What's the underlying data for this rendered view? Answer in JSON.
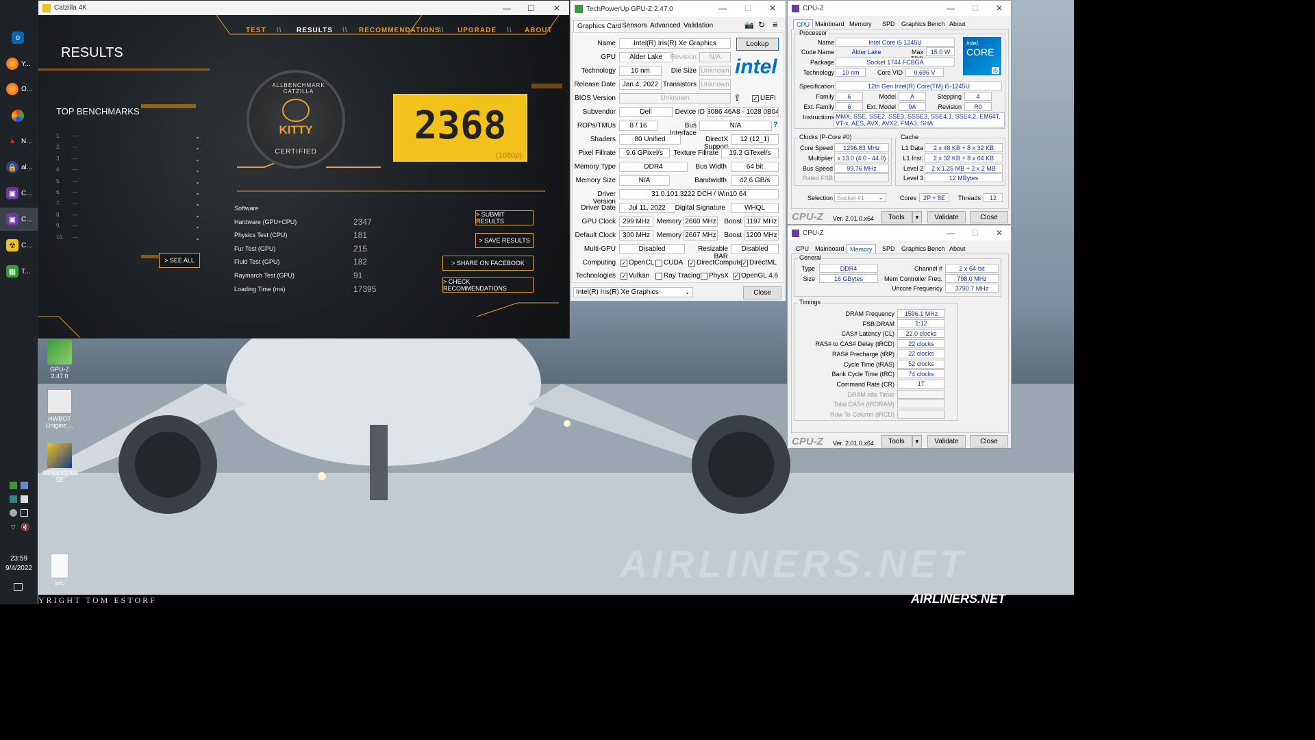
{
  "taskbar": {
    "items": [
      {
        "label": "",
        "icon": "windows-logo-icon"
      },
      {
        "label": "",
        "icon": "outlook-icon"
      },
      {
        "label": "Y...",
        "icon": "firefox-icon"
      },
      {
        "label": "O...",
        "icon": "firefox-icon"
      },
      {
        "label": "",
        "icon": "pinwheel-icon"
      },
      {
        "label": "N...",
        "icon": "acrobat-icon"
      },
      {
        "label": "al...",
        "icon": "lock-app-icon"
      },
      {
        "label": "C...",
        "icon": "cpuz-icon"
      },
      {
        "label": "C...",
        "icon": "cpuz-icon"
      },
      {
        "label": "C...",
        "icon": "catzilla-icon"
      },
      {
        "label": "T...",
        "icon": "gpuz-icon"
      }
    ],
    "clock_time": "23:59",
    "clock_date": "9/4/2022"
  },
  "desktop": {
    "icons": [
      {
        "label": "GPU-Z 2.47.0",
        "icon": "gpuz-shortcut-icon"
      },
      {
        "label": "HWBOT Unigine ...",
        "icon": "hwbot-icon"
      },
      {
        "label": "3DMark2001 SE",
        "icon": "3dmark-icon"
      },
      {
        "label": "info",
        "icon": "file-icon"
      }
    ],
    "watermark": "AIRLINERS.NET",
    "watermark_small": "AIRLINERS.NET",
    "copyright": "YRIGHT TOM ESTORF"
  },
  "catzilla": {
    "window_title": "Catzilla 4K",
    "nav": [
      "TEST",
      "RESULTS",
      "RECOMMENDATIONS",
      "UPGRADE",
      "ABOUT"
    ],
    "nav_sep": "\\\\",
    "results_heading": "RESULTS",
    "top_benchmarks_heading": "TOP BENCHMARKS",
    "top_list": [
      {
        "n": "1.",
        "v": "---"
      },
      {
        "n": "2.",
        "v": "---"
      },
      {
        "n": "3.",
        "v": "---"
      },
      {
        "n": "4.",
        "v": "---"
      },
      {
        "n": "5.",
        "v": "---"
      },
      {
        "n": "6.",
        "v": "---"
      },
      {
        "n": "7.",
        "v": "---"
      },
      {
        "n": "8.",
        "v": "---"
      },
      {
        "n": "9.",
        "v": "---"
      },
      {
        "n": "10.",
        "v": "---"
      }
    ],
    "see_all": "> SEE ALL",
    "badge_top": "ALLBENCHMARK CATZILLA",
    "badge_kitty": "KITTY",
    "badge_bottom": "CERTIFIED",
    "score": "2368",
    "score_res": "(1080p)",
    "results": [
      {
        "label": "Software",
        "value": ""
      },
      {
        "label": "Hardware (GPU+CPU)",
        "value": "2347"
      },
      {
        "label": "Physics Test (CPU)",
        "value": "181"
      },
      {
        "label": "Fur Test (GPU)",
        "value": "215"
      },
      {
        "label": "Fluid Test (GPU)",
        "value": "182"
      },
      {
        "label": "Raymarch Test (GPU)",
        "value": "91"
      },
      {
        "label": "Loading Time (ms)",
        "value": "17395"
      }
    ],
    "buttons": [
      "> SUBMIT RESULTS",
      "> SAVE RESULTS",
      "> SHARE ON FACEBOOK",
      "> CHECK RECOMMENDATIONS"
    ]
  },
  "gpuz": {
    "window_title": "TechPowerUp GPU-Z 2.47.0",
    "tabs": [
      "Graphics Card",
      "Sensors",
      "Advanced",
      "Validation"
    ],
    "lookup": "Lookup",
    "vendor_logo": "intel",
    "name_label": "Name",
    "name": "Intel(R) Iris(R) Xe Graphics",
    "gpu_label": "GPU",
    "gpu": "Alder Lake",
    "revision_label": "Revision",
    "revision": "N/A",
    "technology_label": "Technology",
    "technology": "10 nm",
    "die_size_label": "Die Size",
    "die_size": "Unknown",
    "release_date_label": "Release Date",
    "release_date": "Jan 4, 2022",
    "transistors_label": "Transistors",
    "transistors": "Unknown",
    "bios_label": "BIOS Version",
    "bios": "Unknown",
    "uefi_label": "UEFI",
    "subvendor_label": "Subvendor",
    "subvendor": "Dell",
    "device_id_label": "Device ID",
    "device_id": "8086 46A8 - 1028 0B04",
    "rops_label": "ROPs/TMUs",
    "rops": "8 / 16",
    "bus_label": "Bus Interface",
    "bus": "N/A",
    "shaders_label": "Shaders",
    "shaders": "80 Unified",
    "dx_label": "DirectX Support",
    "dx": "12 (12_1)",
    "pixel_label": "Pixel Fillrate",
    "pixel": "9.6 GPixel/s",
    "texture_label": "Texture Fillrate",
    "texture": "19.2 GTexel/s",
    "memtype_label": "Memory Type",
    "memtype": "DDR4",
    "buswidth_label": "Bus Width",
    "buswidth": "64 bit",
    "memsize_label": "Memory Size",
    "memsize": "N/A",
    "bandwidth_label": "Bandwidth",
    "bandwidth": "42.6 GB/s",
    "driver_label": "Driver Version",
    "driver": "31.0.101.3222 DCH / Win10 64",
    "driverdate_label": "Driver Date",
    "driverdate": "Jul 11, 2022",
    "digsig_label": "Digital Signature",
    "digsig": "WHQL",
    "gpuclock_label": "GPU Clock",
    "gpuclock": "299 MHz",
    "memory_label": "Memory",
    "memclock": "2660 MHz",
    "boost_label": "Boost",
    "boost": "1197 MHz",
    "defclock_label": "Default Clock",
    "defclock": "300 MHz",
    "defmem": "2667 MHz",
    "defboost": "1200 MHz",
    "multigpu_label": "Multi-GPU",
    "multigpu": "Disabled",
    "rebar_label": "Resizable BAR",
    "rebar": "Disabled",
    "computing_label": "Computing",
    "computing": [
      {
        "label": "OpenCL",
        "checked": "✓"
      },
      {
        "label": "CUDA",
        "checked": ""
      },
      {
        "label": "DirectCompute",
        "checked": "✓"
      },
      {
        "label": "DirectML",
        "checked": "✓"
      }
    ],
    "technologies_label": "Technologies",
    "technologies": [
      {
        "label": "Vulkan",
        "checked": "✓"
      },
      {
        "label": "Ray Tracing",
        "checked": ""
      },
      {
        "label": "PhysX",
        "checked": ""
      },
      {
        "label": "OpenGL 4.6",
        "checked": "✓"
      }
    ],
    "selected_gpu": "Intel(R) Iris(R) Xe Graphics",
    "close": "Close"
  },
  "cpuz1": {
    "window_title": "CPU-Z",
    "tabs": [
      "CPU",
      "Mainboard",
      "Memory",
      "SPD",
      "Graphics",
      "Bench",
      "About"
    ],
    "processor_group": "Processor",
    "name_label": "Name",
    "name": "Intel Core i5 1245U",
    "codename_label": "Code Name",
    "codename": "Alder Lake",
    "maxtdp_label": "Max TDP",
    "maxtdp": "15.0 W",
    "package_label": "Package",
    "package": "Socket 1744 FCBGA",
    "technology_label": "Technology",
    "technology": "10 nm",
    "corevid_label": "Core VID",
    "corevid": "0.696 V",
    "spec_label": "Specification",
    "spec": "12th Gen Intel(R) Core(TM) i5-1245U",
    "family_label": "Family",
    "family": "6",
    "model_label": "Model",
    "model": "A",
    "stepping_label": "Stepping",
    "stepping": "4",
    "extfamily_label": "Ext. Family",
    "extfamily": "6",
    "extmodel_label": "Ext. Model",
    "extmodel": "9A",
    "revision_label": "Revision",
    "revision": "R0",
    "instr_label": "Instructions",
    "instr": "MMX, SSE, SSE2, SSE3, SSSE3, SSE4.1, SSE4.2, EM64T, VT-x, AES, AVX, AVX2, FMA3, SHA",
    "logo_brand": "intel.",
    "logo_core": "CORE",
    "logo_tier": "i5",
    "clocks_group": "Clocks (P-Core #0)",
    "corespeed_label": "Core Speed",
    "corespeed": "1296.83 MHz",
    "multiplier_label": "Multiplier",
    "multiplier": "x 13.0 (4.0 - 44.0)",
    "busspeed_label": "Bus Speed",
    "busspeed": "99.76 MHz",
    "ratedfsb_label": "Rated FSB",
    "ratedfsb": "",
    "cache_group": "Cache",
    "l1d_label": "L1 Data",
    "l1d": "2 x 48 KB + 8 x 32 KB",
    "l1i_label": "L1 Inst.",
    "l1i": "2 x 32 KB + 8 x 64 KB",
    "l2_label": "Level 2",
    "l2": "2 x 1.25 MB + 2 x 2 MB",
    "l3_label": "Level 3",
    "l3": "12 MBytes",
    "selection_label": "Selection",
    "selection": "Socket #1",
    "cores_label": "Cores",
    "cores": "2P + 8E",
    "threads_label": "Threads",
    "threads": "12",
    "brand": "CPU-Z",
    "version": "Ver. 2.01.0.x64",
    "tools": "Tools",
    "validate": "Validate",
    "close": "Close"
  },
  "cpuz2": {
    "window_title": "CPU-Z",
    "tabs": [
      "CPU",
      "Mainboard",
      "Memory",
      "SPD",
      "Graphics",
      "Bench",
      "About"
    ],
    "general_group": "General",
    "type_label": "Type",
    "type": "DDR4",
    "channel_label": "Channel #",
    "channel": "2 x 64-bit",
    "size_label": "Size",
    "size": "16 GBytes",
    "mcf_label": "Mem Controller Freq.",
    "mcf": "798.0 MHz",
    "uncore_label": "Uncore Frequency",
    "uncore": "3790.7 MHz",
    "timings_group": "Timings",
    "timings": [
      {
        "label": "DRAM Frequency",
        "value": "1596.1 MHz",
        "enabled": "yes"
      },
      {
        "label": "FSB:DRAM",
        "value": "1:12",
        "enabled": "yes"
      },
      {
        "label": "CAS# Latency (CL)",
        "value": "22.0 clocks",
        "enabled": "yes"
      },
      {
        "label": "RAS# to CAS# Delay (tRCD)",
        "value": "22 clocks",
        "enabled": "yes"
      },
      {
        "label": "RAS# Precharge (tRP)",
        "value": "22 clocks",
        "enabled": "yes"
      },
      {
        "label": "Cycle Time (tRAS)",
        "value": "52 clocks",
        "enabled": "yes"
      },
      {
        "label": "Bank Cycle Time (tRC)",
        "value": "74 clocks",
        "enabled": "yes"
      },
      {
        "label": "Command Rate (CR)",
        "value": "1T",
        "enabled": "yes"
      },
      {
        "label": "DRAM Idle Timer",
        "value": "",
        "enabled": "no"
      },
      {
        "label": "Total CAS# (tRDRAM)",
        "value": "",
        "enabled": "no"
      },
      {
        "label": "Row To Column (tRCD)",
        "value": "",
        "enabled": "no"
      }
    ],
    "brand": "CPU-Z",
    "version": "Ver. 2.01.0.x64",
    "tools": "Tools",
    "validate": "Validate",
    "close": "Close"
  }
}
